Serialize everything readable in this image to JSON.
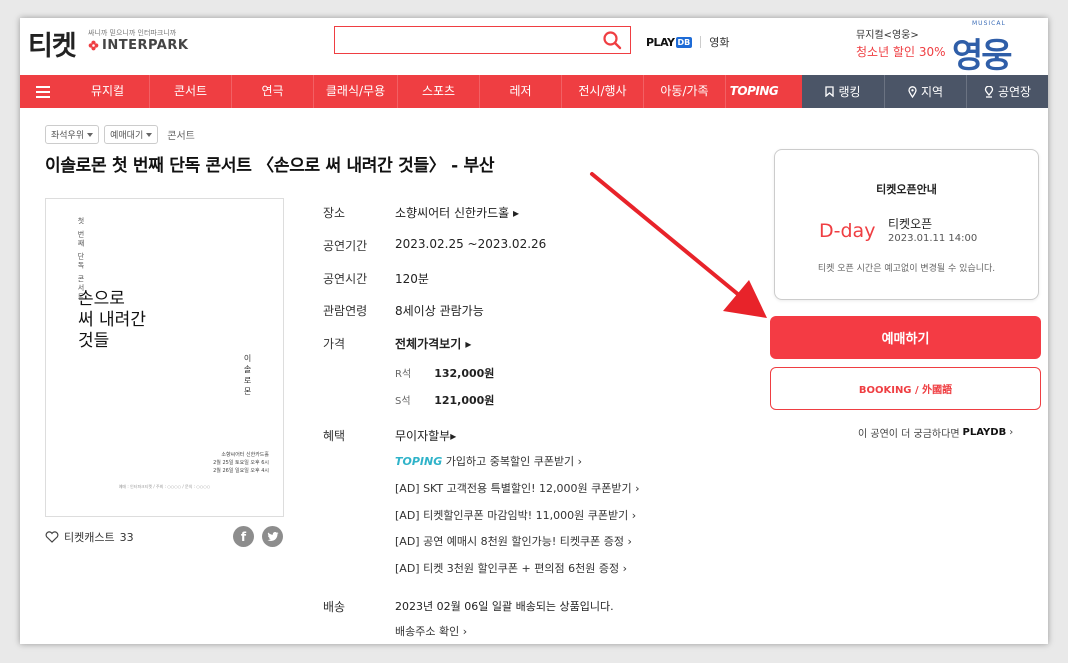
{
  "header": {
    "logo": "티켓",
    "interpark_tagline": "싸니까 믿으니까 인터파크니까",
    "interpark_name": "INTERPARK",
    "search_placeholder": "",
    "playdb_left": "PLAY",
    "playdb_right": "DB",
    "movie_link": "영화",
    "promo_line1": "뮤지컬<영웅>",
    "promo_line2": "청소년 할인 30%",
    "promo_art_top": "MUSICAL",
    "promo_art_title": "영웅"
  },
  "nav": {
    "menu_icon": "hamburger-icon",
    "items": [
      "뮤지컬",
      "콘서트",
      "연극",
      "클래식/무용",
      "스포츠",
      "레저",
      "전시/행사",
      "아동/가족",
      "TOPING"
    ],
    "right_items": [
      {
        "label": "랭킹",
        "icon": "bookmark-icon"
      },
      {
        "label": "지역",
        "icon": "location-pin-icon"
      },
      {
        "label": "공연장",
        "icon": "venue-pin-icon"
      }
    ]
  },
  "breadcrumb": {
    "chip1": "좌석우위",
    "chip2": "예매대기",
    "category": "콘서트"
  },
  "title": "이솔로몬 첫 번째 단독 콘서트 〈손으로 써 내려간 것들〉 - 부산",
  "poster": {
    "vertical_small": "첫 번째 단독 콘서트",
    "main_lines": [
      "손으로",
      "써 내려간",
      "것들"
    ],
    "artist_vertical": "이솔로몬",
    "venue_lines": [
      "소향씨어터 신한카드홀",
      "2월 25일 토요일 오후 6시",
      "2월 26일 일요일 오후 4시"
    ],
    "fine_print": "예매 : 인터파크티켓 / 주최 : ○○○○ / 문의 : ○○○○"
  },
  "cast": {
    "label": "티켓캐스트",
    "count": "33",
    "facebook": "f",
    "twitter": "t"
  },
  "info": {
    "venue_label": "장소",
    "venue_value": "소향씨어터 신한카드홀",
    "period_label": "공연기간",
    "period_value": "2023.02.25 ~2023.02.26",
    "runtime_label": "공연시간",
    "runtime_value": "120분",
    "age_label": "관람연령",
    "age_value": "8세이상 관람가능",
    "price_label": "가격",
    "price_all": "전체가격보기",
    "prices": [
      {
        "grade": "R석",
        "price": "132,000원"
      },
      {
        "grade": "S석",
        "price": "121,000원"
      }
    ],
    "benefit_label": "혜택",
    "benefit_main": "무이자할부",
    "benefit_toping": "TOPING",
    "benefit_toping_text": "가입하고 중복할인 쿠폰받기",
    "benefits": [
      "[AD] SKT 고객전용 특별할인! 12,000원 쿠폰받기",
      "[AD] 티켓할인쿠폰 마감임박! 11,000원 쿠폰받기",
      "[AD] 공연 예매시 8천원 할인가능! 티켓쿠폰 증정",
      "[AD] 티켓 3천원 할인쿠폰 + 편의점 6천원 증정"
    ],
    "delivery_label": "배송",
    "delivery_value": "2023년 02월 06일 일괄 배송되는 상품입니다.",
    "delivery_link": "배송주소 확인"
  },
  "side": {
    "card_title": "티켓오픈안내",
    "dday": "D-day",
    "ticket_open_label": "티켓오픈",
    "ticket_open_date": "2023.01.11 14:00",
    "note": "티켓 오픈 시간은 예고없이 변경될 수 있습니다.",
    "book_button": "예매하기",
    "booking_en": "BOOKING / 外國語",
    "more_text": "이 공연이 더 궁금하다면",
    "more_pd": "PLAYDB"
  },
  "colors": {
    "brand_red": "#ef3e42",
    "nav_dark": "#4b5567",
    "toping": "#2fb3c9",
    "playdb_blue": "#1e6bd6"
  }
}
